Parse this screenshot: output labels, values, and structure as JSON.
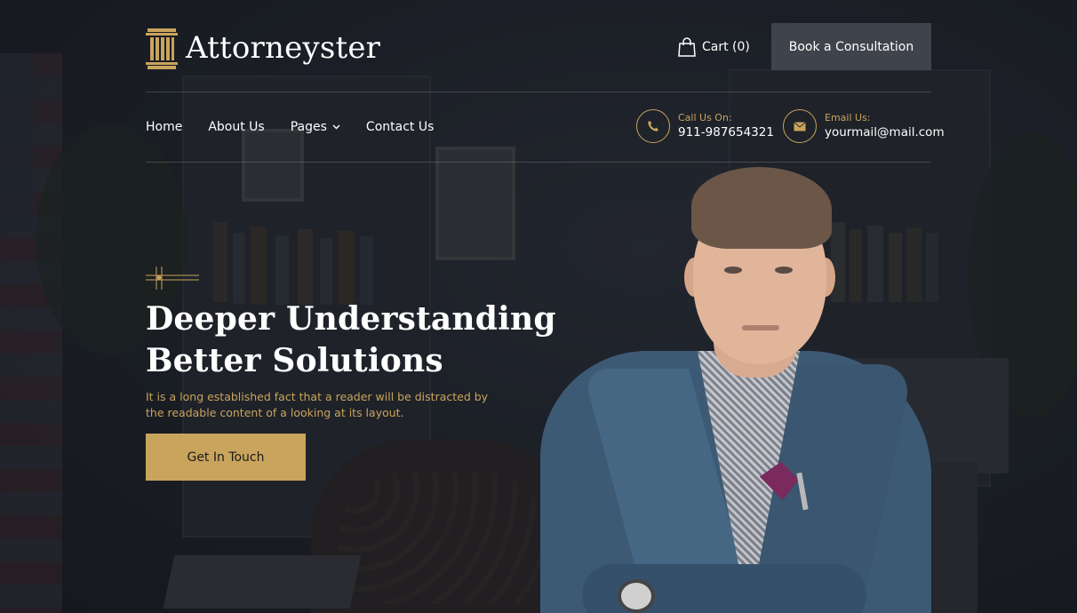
{
  "brand": {
    "name": "Attorneyster",
    "logo_icon": "pillar-icon"
  },
  "header": {
    "cart_label": "Cart (0)",
    "cart_icon": "shopping-bag-icon",
    "cta_label": "Book a Consultation"
  },
  "nav": {
    "items": [
      {
        "label": "Home"
      },
      {
        "label": "About Us"
      },
      {
        "label": "Pages",
        "has_dropdown": true
      },
      {
        "label": "Contact Us"
      }
    ]
  },
  "contact": {
    "phone": {
      "label": "Call Us On:",
      "value": "911-987654321",
      "icon": "phone-icon"
    },
    "email": {
      "label": "Email Us:",
      "value": "yourmail@mail.com",
      "icon": "envelope-icon"
    }
  },
  "hero": {
    "headline_line1": "Deeper Understanding",
    "headline_line2": "Better Solutions",
    "subtext": "It is a long established fact that a reader will be distracted by the readable content of a looking at its layout.",
    "cta_label": "Get In Touch"
  },
  "colors": {
    "accent": "#c9a45c",
    "dark_button": "#3f434b",
    "background": "#1b1e24"
  }
}
